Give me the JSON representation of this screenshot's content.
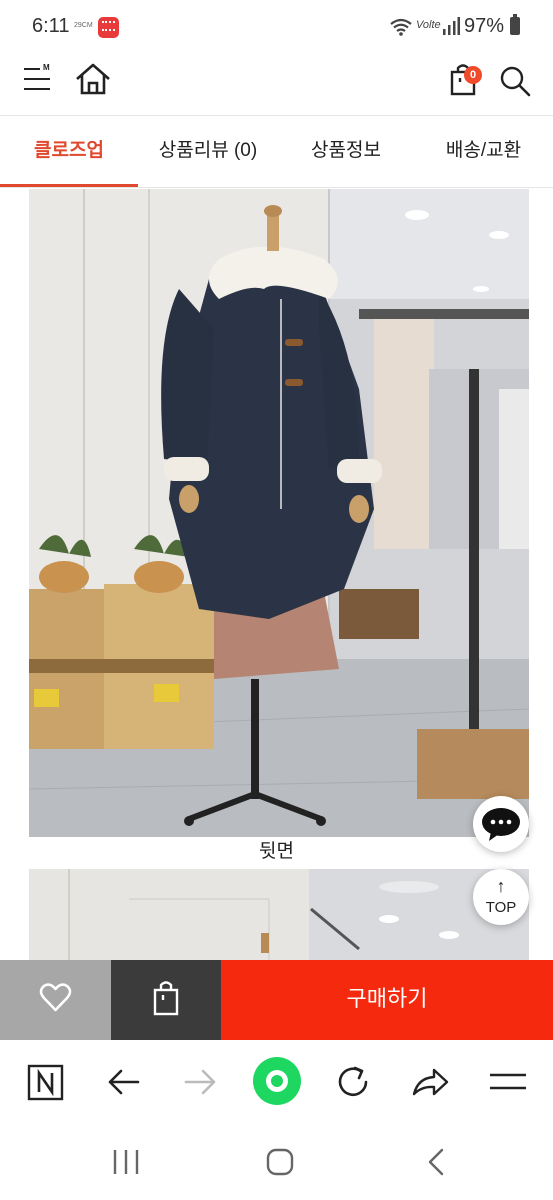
{
  "status_bar": {
    "time": "6:11",
    "tiny_label": "29CM",
    "network": "Volte",
    "battery": "97%"
  },
  "header": {
    "menu_letter": "M",
    "cart_count": "0"
  },
  "tabs": [
    {
      "label": "클로즈업",
      "active": true
    },
    {
      "label": "상품리뷰 (0)",
      "active": false
    },
    {
      "label": "상품정보",
      "active": false
    },
    {
      "label": "배송/교환",
      "active": false
    }
  ],
  "content": {
    "caption": "뒷면"
  },
  "floating": {
    "top_label": "TOP",
    "top_arrow": "↑"
  },
  "purchase_bar": {
    "buy_label": "구매하기"
  },
  "colors": {
    "accent": "#e0492e",
    "buy_button": "#f5290e",
    "wish_button": "#a7a7a7",
    "bag_button": "#3b3b3b",
    "browser_home": "#1ed760"
  },
  "icons": {
    "menu": "hamburger-menu-icon",
    "home": "home-icon",
    "cart": "shopping-bag-icon",
    "search": "search-icon",
    "chat": "chat-icon",
    "wish": "heart-icon",
    "bag": "bag-icon",
    "browser": [
      "naver-n-icon",
      "back-arrow-icon",
      "forward-arrow-icon",
      "home-circle-icon",
      "refresh-icon",
      "share-icon",
      "browser-menu-icon"
    ],
    "nav": [
      "recent-apps-icon",
      "home-nav-icon",
      "back-nav-icon"
    ]
  }
}
